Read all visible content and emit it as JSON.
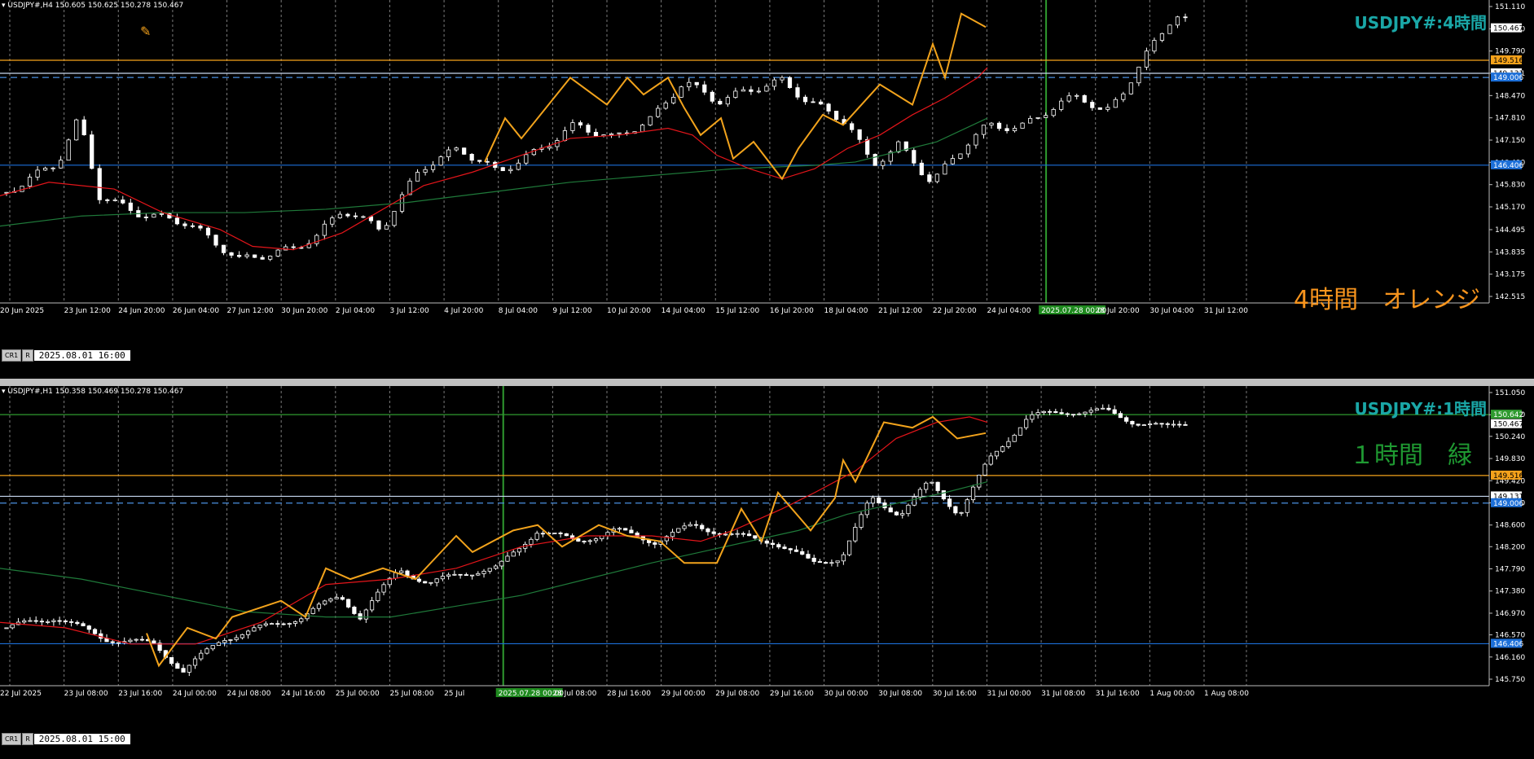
{
  "colors": {
    "bull": "#ffffff",
    "bear": "#ffffff",
    "ma_fast": "#e3151a",
    "ma_slow": "#1f7a3a",
    "zigzag": "#f2a31c",
    "grid": "#7a7a7a",
    "orange_line": "#f5a21b",
    "blue_line": "#1c6fd8",
    "dash_line": "#4a8fe0",
    "white_line": "#c8d8f0",
    "green_line": "#2f9a2f",
    "axis_bg": "#000000",
    "watermark": "#1aa7a7",
    "label_orange": "#f7941d",
    "label_green": "#1f9a32"
  },
  "panes": [
    {
      "id": "h4",
      "header": "USDJPY#,H4  150.605 150.625 150.278 150.467",
      "watermark": "USDJPY#:4時間",
      "big_label": "4時間　オレンジ",
      "date_button_left": "CR1",
      "date_button_right": "R",
      "date_value": "2025.08.01 16:00",
      "price_min": 142.515,
      "price_max": 151.11,
      "price_ticks": [
        "151.110",
        "150.450",
        "149.790",
        "149.131",
        "148.470",
        "147.810",
        "147.150",
        "146.490",
        "145.830",
        "145.170",
        "144.495",
        "143.835",
        "143.175",
        "142.515"
      ],
      "price_labels": [
        {
          "text": "150.467",
          "price": 150.467,
          "bg": "#ffffff",
          "fg": "#000000"
        },
        {
          "text": "149.516",
          "price": 149.516,
          "bg": "#f5a21b",
          "fg": "#000000"
        },
        {
          "text": "149.131",
          "price": 149.131,
          "bg": "#ffffff",
          "fg": "#000000"
        },
        {
          "text": "149.006",
          "price": 149.006,
          "bg": "#1c6fd8",
          "fg": "#ffffff"
        },
        {
          "text": "146.406",
          "price": 146.406,
          "bg": "#1c6fd8",
          "fg": "#ffffff"
        }
      ],
      "time_labels": [
        "20 Jun 2025",
        "23 Jun 12:00",
        "24 Jun 20:00",
        "26 Jun 04:00",
        "27 Jun 12:00",
        "30 Jun 20:00",
        "2 Jul 04:00",
        "3 Jul 12:00",
        "4 Jul 20:00",
        "8 Jul 04:00",
        "9 Jul 12:00",
        "10 Jul 20:00",
        "14 Jul 04:00",
        "15 Jul 12:00",
        "16 Jul 20:00",
        "18 Jul 04:00",
        "21 Jul 12:00",
        "22 Jul 20:00",
        "24 Jul 04:00",
        "2025.07.28 00:00",
        "28 Jul 20:00",
        "30 Jul 04:00",
        "31 Jul 12:00"
      ],
      "time_highlight_index": 19,
      "hlines": [
        {
          "price": 149.516,
          "color": "#f5a21b",
          "style": "solid"
        },
        {
          "price": 149.131,
          "color": "#c8d8f0",
          "style": "solid"
        },
        {
          "price": 149.006,
          "color": "#4a8fe0",
          "style": "dash"
        },
        {
          "price": 146.406,
          "color": "#1c6fd8",
          "style": "solid"
        }
      ],
      "big_label_color": "#f7941d"
    },
    {
      "id": "h1",
      "header": "USDJPY#,H1  150.358 150.469 150.278 150.467",
      "watermark": "USDJPY#:1時間",
      "big_label": "１時間　緑",
      "date_button_left": "CR1",
      "date_button_right": "R",
      "date_value": "2025.08.01 15:00",
      "price_min": 145.75,
      "price_max": 151.05,
      "price_ticks": [
        "151.050",
        "150.640",
        "150.240",
        "149.830",
        "149.420",
        "149.010",
        "148.600",
        "148.200",
        "147.790",
        "147.380",
        "146.970",
        "146.570",
        "146.160",
        "145.750"
      ],
      "price_labels": [
        {
          "text": "150.642",
          "price": 150.642,
          "bg": "#2f9a2f",
          "fg": "#ffffff"
        },
        {
          "text": "150.467",
          "price": 150.467,
          "bg": "#ffffff",
          "fg": "#000000"
        },
        {
          "text": "149.516",
          "price": 149.516,
          "bg": "#f5a21b",
          "fg": "#000000"
        },
        {
          "text": "149.131",
          "price": 149.131,
          "bg": "#ffffff",
          "fg": "#000000"
        },
        {
          "text": "149.006",
          "price": 149.006,
          "bg": "#1c6fd8",
          "fg": "#ffffff"
        },
        {
          "text": "146.406",
          "price": 146.406,
          "bg": "#1c6fd8",
          "fg": "#ffffff"
        }
      ],
      "time_labels": [
        "22 Jul 2025",
        "23 Jul 08:00",
        "23 Jul 16:00",
        "24 Jul 00:00",
        "24 Jul 08:00",
        "24 Jul 16:00",
        "25 Jul 00:00",
        "25 Jul 08:00",
        "25 Jul",
        "2025.07.28 00:00",
        "28 Jul 08:00",
        "28 Jul 16:00",
        "29 Jul 00:00",
        "29 Jul 08:00",
        "29 Jul 16:00",
        "30 Jul 00:00",
        "30 Jul 08:00",
        "30 Jul 16:00",
        "31 Jul 00:00",
        "31 Jul 08:00",
        "31 Jul 16:00",
        "1 Aug 00:00",
        "1 Aug 08:00"
      ],
      "time_highlight_index": 9,
      "hlines": [
        {
          "price": 150.642,
          "color": "#2f9a2f",
          "style": "solid"
        },
        {
          "price": 149.516,
          "color": "#f5a21b",
          "style": "solid"
        },
        {
          "price": 149.131,
          "color": "#c8d8f0",
          "style": "solid"
        },
        {
          "price": 149.006,
          "color": "#4a8fe0",
          "style": "dash"
        },
        {
          "price": 146.406,
          "color": "#1c6fd8",
          "style": "solid"
        }
      ],
      "big_label_color": "#1f9a32"
    }
  ]
}
